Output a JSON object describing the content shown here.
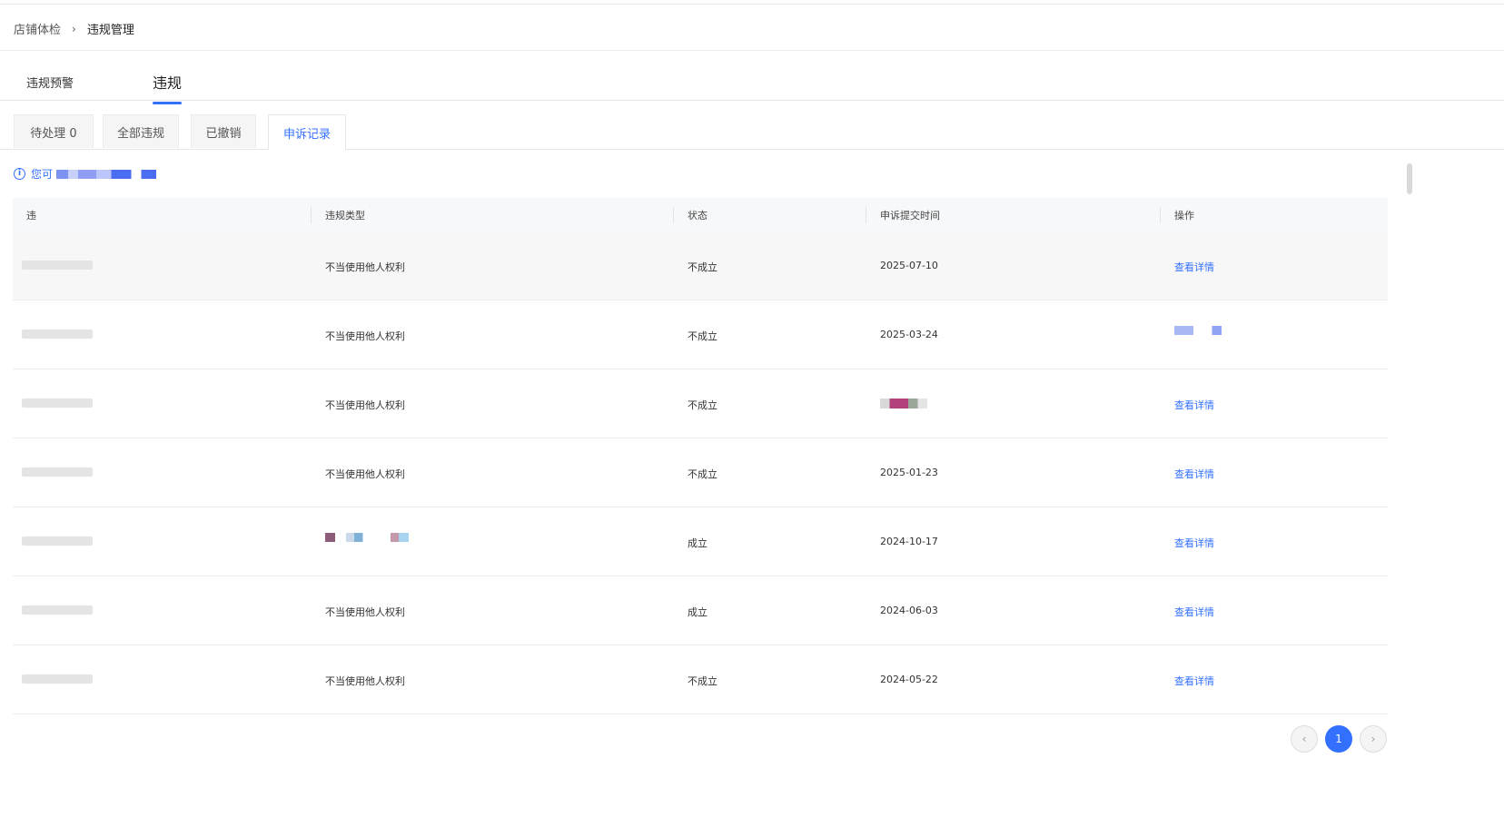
{
  "breadcrumb": {
    "parent": "店铺体检",
    "separator": "›",
    "current": "违规管理"
  },
  "main_tabs": [
    "违规预警",
    "违规"
  ],
  "sub_tabs": [
    "待处理 0",
    "全部违规",
    "已撤销",
    "申诉记录"
  ],
  "notice": {
    "prefix": "您可"
  },
  "table": {
    "headers": [
      "违",
      "违规类型",
      "状态",
      "申诉提交时间",
      "操作"
    ],
    "rows": [
      {
        "type": "不当使用他人权利",
        "status": "不成立",
        "time": "2025-07-10",
        "action": "查看详情"
      },
      {
        "type": "不当使用他人权利",
        "status": "不成立",
        "time": "2025-03-24",
        "action": ""
      },
      {
        "type": "不当使用他人权利",
        "status": "不成立",
        "time": "",
        "action": "查看详情"
      },
      {
        "type": "不当使用他人权利",
        "status": "不成立",
        "time": "2025-01-23",
        "action": "查看详情"
      },
      {
        "type": "",
        "status": "成立",
        "time": "2024-10-17",
        "action": "查看详情"
      },
      {
        "type": "不当使用他人权利",
        "status": "成立",
        "time": "2024-06-03",
        "action": "查看详情"
      },
      {
        "type": "不当使用他人权利",
        "status": "不成立",
        "time": "2024-05-22",
        "action": "查看详情"
      }
    ]
  },
  "pagination": {
    "prev": "‹",
    "current": "1",
    "next": "›"
  },
  "colors": {
    "accent": "#3370ff",
    "header_bg": "#f7f8fa"
  }
}
